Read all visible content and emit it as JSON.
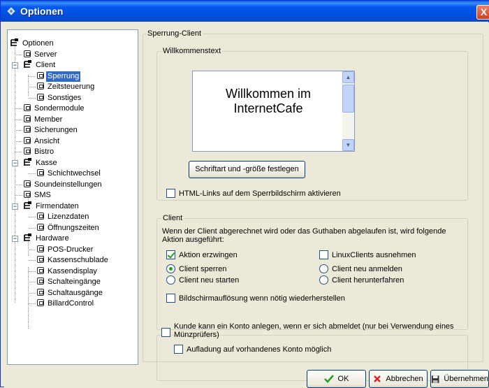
{
  "window": {
    "title": "Optionen",
    "close_label": "X"
  },
  "tree": {
    "items": [
      {
        "label": "Optionen"
      },
      {
        "label": "Server"
      },
      {
        "label": "Client"
      },
      {
        "label": "Sperrung"
      },
      {
        "label": "Zeitsteuerung"
      },
      {
        "label": "Sonstiges"
      },
      {
        "label": "Sondermodule"
      },
      {
        "label": "Member"
      },
      {
        "label": "Sicherungen"
      },
      {
        "label": "Ansicht"
      },
      {
        "label": "Bistro"
      },
      {
        "label": "Kasse"
      },
      {
        "label": "Schichtwechsel"
      },
      {
        "label": "Soundeinstellungen"
      },
      {
        "label": "SMS"
      },
      {
        "label": "Firmendaten"
      },
      {
        "label": "Lizenzdaten"
      },
      {
        "label": "Öffnungszeiten"
      },
      {
        "label": "Hardware"
      },
      {
        "label": "POS-Drucker"
      },
      {
        "label": "Kassenschublade"
      },
      {
        "label": "Kassendisplay"
      },
      {
        "label": "Schalteingänge"
      },
      {
        "label": "Schaltausgänge"
      },
      {
        "label": "BillardControl"
      }
    ],
    "selected": "Sperrung"
  },
  "panel": {
    "title": "Sperrung-Client",
    "welcome": {
      "legend": "Willkommenstext",
      "text": "Willkommen im\nInternetCafe",
      "font_button": "Schriftart und -größe festlegen",
      "html_links_label": "HTML-Links auf dem Sperrbildschirm aktivieren",
      "html_links_checked": false
    },
    "client": {
      "legend": "Client",
      "description": "Wenn der Client abgerechnet wird oder das Guthaben abgelaufen ist, wird folgende Aktion ausgeführt:",
      "force_action_label": "Aktion erzwingen",
      "force_action_checked": true,
      "linux_exclude_label": "LinuxClients ausnehmen",
      "linux_exclude_checked": false,
      "radio_lock": "Client sperren",
      "radio_relogin": "Client neu anmelden",
      "radio_restart": "Client neu starten",
      "radio_shutdown": "Client herunterfahren",
      "selected_radio": "Client sperren",
      "restore_resolution_label": "Bildschirmauflösung wenn nötig wiederherstellen",
      "restore_resolution_checked": false
    },
    "account": {
      "create_account_label": "Kunde kann ein Konto anlegen, wenn er sich abmeldet (nur bei Verwendung eines Münzprüfers)",
      "create_account_checked": false,
      "topup_label": "Aufladung auf vorhandenes Konto möglich",
      "topup_checked": false
    }
  },
  "buttons": {
    "ok": "OK",
    "cancel": "Abbrechen",
    "apply": "Übernehmen"
  },
  "colors": {
    "accent": "#316ac5",
    "titlebar": "#0058ee",
    "check": "#21a121",
    "cancel_x": "#e02020"
  }
}
